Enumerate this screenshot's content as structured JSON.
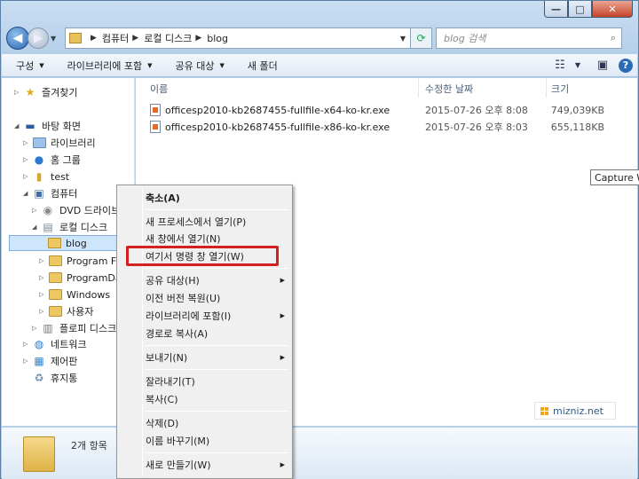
{
  "window": {
    "minimize_label": "—",
    "maximize_label": "□",
    "close_label": "✕"
  },
  "address": {
    "back_icon": "◀",
    "forward_icon": "▶",
    "breadcrumbs": [
      "컴퓨터",
      "로컬 디스크",
      "blog"
    ],
    "search_placeholder": "blog 검색"
  },
  "toolbar": {
    "organize": "구성",
    "include_library": "라이브러리에 포함",
    "share_with": "공유 대상",
    "new_folder": "새 폴더"
  },
  "nav": {
    "favorites": "즐겨찾기",
    "desktop": "바탕 화면",
    "libraries": "라이브러리",
    "homegroup": "홈 그룹",
    "test": "test",
    "computer": "컴퓨터",
    "dvd": "DVD 드라이브",
    "local_disk": "로컬 디스크",
    "blog": "blog",
    "program_files": "Program Files",
    "program_data": "ProgramData",
    "windows": "Windows",
    "users": "사용자",
    "floppy": "플로피 디스크",
    "network": "네트워크",
    "control_panel": "제어판",
    "recycle_bin": "휴지통"
  },
  "columns": {
    "name": "이름",
    "date": "수정한 날짜",
    "size": "크기"
  },
  "files": [
    {
      "name": "officesp2010-kb2687455-fullfile-x64-ko-kr.exe",
      "date": "2015-07-26 오후 8:08",
      "size": "749,039KB"
    },
    {
      "name": "officesp2010-kb2687455-fullfile-x86-ko-kr.exe",
      "date": "2015-07-26 오후 8:03",
      "size": "655,118KB"
    }
  ],
  "tooltip": "Capture W",
  "watermark": "mizniz.net",
  "details": {
    "item_count": "2개 항목"
  },
  "context_menu": {
    "expand": "축소(A)",
    "open_new_process": "새 프로세스에서 열기(P)",
    "open_new_window": "새 창에서 열기(N)",
    "open_cmd_here": "여기서 명령 창 열기(W)",
    "share_with": "공유 대상(H)",
    "restore_previous": "이전 버전 복원(U)",
    "include_library": "라이브러리에 포함(I)",
    "copy_as_path": "경로로 복사(A)",
    "send_to": "보내기(N)",
    "cut": "잘라내기(T)",
    "copy": "복사(C)",
    "delete": "삭제(D)",
    "rename": "이름 바꾸기(M)",
    "new": "새로 만들기(W)"
  },
  "colors": {
    "highlight_border": "#d42020",
    "selection": "#cde6fb",
    "accent": "#2c6bb8"
  }
}
